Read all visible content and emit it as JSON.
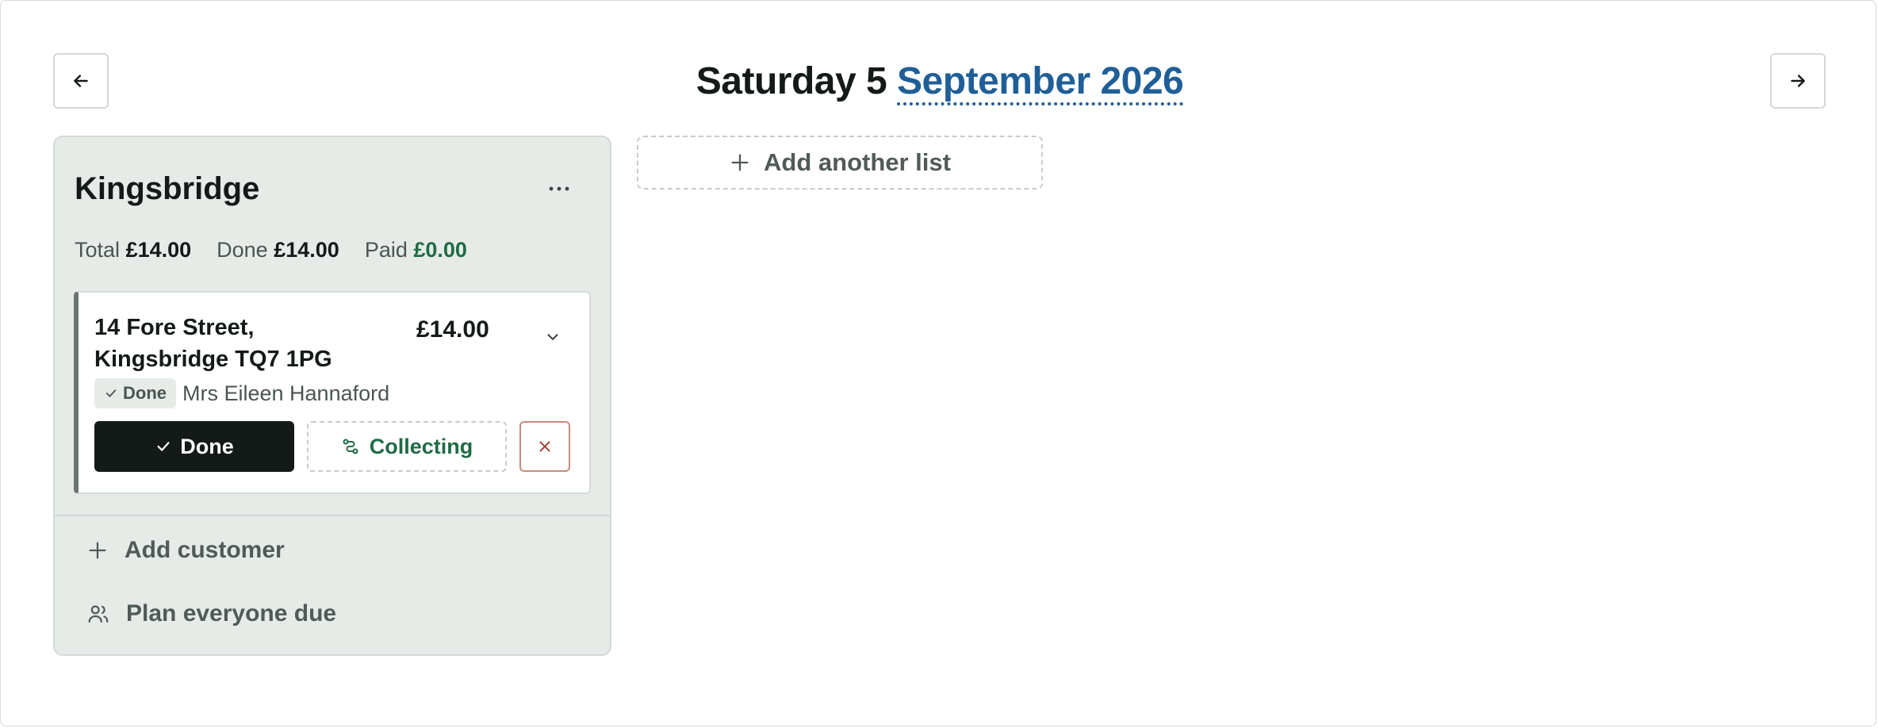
{
  "header": {
    "day_label": "Saturday 5",
    "month_label": "September 2026",
    "prev_icon": "arrow-left-icon",
    "next_icon": "arrow-right-icon"
  },
  "list": {
    "title": "Kingsbridge",
    "more_icon": "more-horizontal-icon",
    "totals": {
      "total_label": "Total",
      "total_value": "£14.00",
      "done_label": "Done",
      "done_value": "£14.00",
      "paid_label": "Paid",
      "paid_value": "£0.00"
    },
    "customers": [
      {
        "address_line1": "14 Fore Street,",
        "address_line2": "Kingsbridge TQ7 1PG",
        "amount": "£14.00",
        "status_badge": "Done",
        "name": "Mrs Eileen Hannaford",
        "done_button": "Done",
        "collecting_button": "Collecting",
        "expand_icon": "chevron-down-icon",
        "remove_icon": "close-icon"
      }
    ],
    "add_customer_label": "Add customer",
    "plan_everyone_label": "Plan everyone due"
  },
  "add_list_label": "Add another list",
  "colors": {
    "accent_link": "#1f5f97",
    "paid_green": "#1f6b45",
    "panel_bg": "#e6ebe8",
    "primary_button": "#141a18",
    "danger_border": "#c98a7c"
  }
}
